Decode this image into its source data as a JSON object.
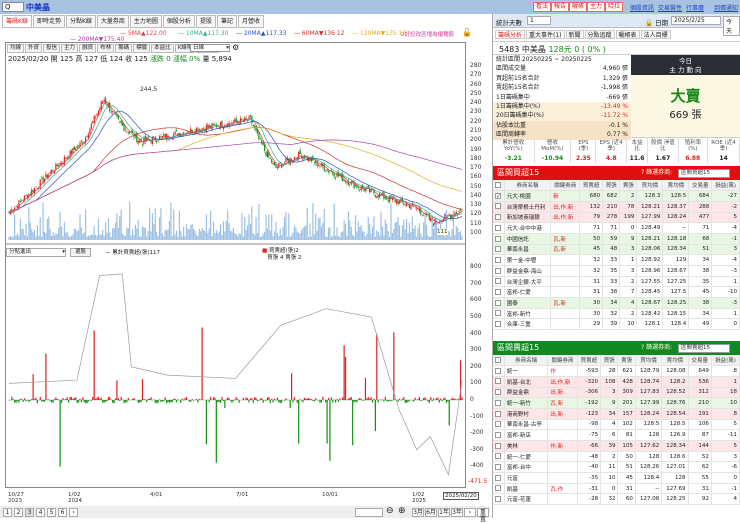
{
  "header": {
    "search": "Q",
    "stock_name": "中美晶",
    "buttons": [
      "看法",
      "報告",
      "曬帳",
      "主力",
      "哈拉"
    ],
    "links": [
      "個股資訊",
      "交易醫性",
      "行事曆",
      "到價通知"
    ]
  },
  "tabs": [
    "籌碼K線",
    "即時走勢",
    "分點K線",
    "大量券商",
    "主力地圖",
    "個股分析",
    "提股",
    "筆記",
    "月營收"
  ],
  "ma": [
    {
      "label": "5MA",
      "dir": "▲",
      "value": "122.00",
      "color": "#e04050"
    },
    {
      "label": "10MA",
      "dir": "▲",
      "value": "117.30",
      "color": "#30b090"
    },
    {
      "label": "20MA",
      "dir": "▲",
      "value": "117.33",
      "color": "#3050c0"
    },
    {
      "label": "60MA",
      "dir": "▼",
      "value": "136.12",
      "color": "#d03030"
    },
    {
      "label": "120MA",
      "dir": "▼",
      "value": "135.15",
      "color": "#e0b020"
    },
    {
      "label": "200MA",
      "dir": "▼",
      "value": "175.40",
      "color": "#b040b0"
    }
  ],
  "chart_hint": "⊙好記改區塊為優種股",
  "toolbar": [
    "均線",
    "外資",
    "投信",
    "主力",
    "融資",
    "布林",
    "籌碼",
    "標籤",
    "本益比",
    "K線帶",
    "分價圖"
  ],
  "period_select": "日線",
  "ohlc": {
    "date": "2025/02/20",
    "open_label": "開",
    "open": "125",
    "high_label": "高",
    "high": "127",
    "low_label": "低",
    "low": "124",
    "close_label": "收",
    "close": "125",
    "change_label": "漲跌",
    "change": "0",
    "pct_label": "漲幅",
    "pct": "0%",
    "vol_label": "量",
    "vol": "5,894"
  },
  "peak_label": "244.5",
  "low_label": "111",
  "price_axis": [
    "280",
    "270",
    "260",
    "250",
    "240",
    "230",
    "220",
    "210",
    "200",
    "190",
    "180",
    "170",
    "160",
    "150",
    "140",
    "130",
    "120",
    "110",
    "100"
  ],
  "lower": {
    "select": "分點進出",
    "button": "選股",
    "legend_line": "累計買賣超(張)117",
    "legend_bar": "買賣超(張)2",
    "legend_sub": "買張 4 賣張 2",
    "axis": [
      "800",
      "700",
      "600",
      "500",
      "400",
      "300",
      "200",
      "100",
      "0",
      "-100",
      "-200",
      "-300",
      "-400"
    ],
    "last_label": "-471.5"
  },
  "dates": [
    {
      "d": "10/27",
      "y": "2023"
    },
    {
      "d": "1/02",
      "y": "2024"
    },
    {
      "d": "4/01",
      "y": ""
    },
    {
      "d": "7/01",
      "y": ""
    },
    {
      "d": "10/01",
      "y": ""
    },
    {
      "d": "1/02",
      "y": "2025"
    }
  ],
  "current_date": "2025/02/20",
  "pages": [
    "1",
    "2",
    "3",
    "4",
    "5",
    "6",
    "›"
  ],
  "zoom_ranges": [
    "3月",
    "6月",
    "1年",
    "3年",
    "›",
    "重置"
  ],
  "chart_data": {
    "type": "candlestick",
    "price_keypoints": [
      [
        "2023/10/27",
        122
      ],
      [
        "2023/11/20",
        145
      ],
      [
        "2023/12/20",
        175
      ],
      [
        "2024/01/15",
        200
      ],
      [
        "2024/02/05",
        244.5
      ],
      [
        "2024/02/20",
        220
      ],
      [
        "2024/03/15",
        198
      ],
      [
        "2024/04/15",
        205
      ],
      [
        "2024/05/15",
        212
      ],
      [
        "2024/06/15",
        218
      ],
      [
        "2024/07/10",
        222
      ],
      [
        "2024/07/20",
        198
      ],
      [
        "2024/08/05",
        170
      ],
      [
        "2024/09/01",
        185
      ],
      [
        "2024/10/01",
        168
      ],
      [
        "2024/11/01",
        150
      ],
      [
        "2024/12/01",
        138
      ],
      [
        "2025/01/02",
        128
      ],
      [
        "2025/01/20",
        111
      ],
      [
        "2025/02/20",
        125
      ]
    ],
    "y_range": [
      100,
      280
    ],
    "net_y_range": [
      -471.5,
      800
    ]
  },
  "right": {
    "days_label": "統計天數",
    "days": "1",
    "date_label": "日期",
    "date": "2025/2/25",
    "today_btn": "今天",
    "tabs": [
      "籌碼分析",
      "重大事件(1)",
      "新聞",
      "分點追蹤",
      "曬帳表",
      "法人目標"
    ],
    "stock": {
      "code_name": "5483 中美晶",
      "price": "128元 0 ( 0% )"
    },
    "stats_period": "統計區間  20250225 ~ 20250225",
    "stats": [
      {
        "k": "區間成交量",
        "v": "4,960 張"
      },
      {
        "k": "買超前15名合計",
        "v": "1,329 張"
      },
      {
        "k": "賣超前15名合計",
        "v": "-1,998 張"
      },
      {
        "k": "1日籌碼集中",
        "v": "-669 張"
      },
      {
        "k": "1日籌碼集中(%)",
        "v": "-13.49 %"
      },
      {
        "k": "20日籌碼集中(%)",
        "v": "-11.72 %"
      },
      {
        "k": "佔股本比重",
        "v": "-0.1 %"
      },
      {
        "k": "區間周轉率",
        "v": "0.77 %"
      }
    ],
    "today": {
      "t1": "今日",
      "t2": "主 力 動 向",
      "verdict": "大賣",
      "amount": "669 張"
    },
    "fund": [
      {
        "h": "累計營收 YoY(%)",
        "v": "-3.21",
        "c": "#1a8a1a"
      },
      {
        "h": "營收 MoM(%)",
        "v": "-10.94",
        "c": "#1a8a1a"
      },
      {
        "h": "EPS (季)",
        "v": "2.35",
        "c": "#d22"
      },
      {
        "h": "EPS (近4季)",
        "v": "4.8",
        "c": "#d22"
      },
      {
        "h": "本益比",
        "v": "11.6",
        "c": "#222"
      },
      {
        "h": "股價 淨值比",
        "v": "1.67",
        "c": "#222"
      },
      {
        "h": "殖利率 (%)",
        "v": "6.88",
        "c": "#d22"
      },
      {
        "h": "ROE (近4季)",
        "v": "14",
        "c": "#222"
      }
    ],
    "buy": {
      "title": "區間買超15",
      "filter_label": "篩選券商:",
      "filter": "區間買超15",
      "cols": [
        "券商名稱",
        "關鍵券商",
        "買賣超",
        "買張",
        "賣張",
        "買均價",
        "賣均價",
        "交易量",
        "損益(萬)"
      ],
      "rows": [
        [
          "元大-桃園",
          "新",
          "680",
          "682",
          "2",
          "128.3",
          "128.5",
          "684",
          "-27",
          "g"
        ],
        [
          "台灣摩根士丹利",
          "出,作,新",
          "132",
          "210",
          "78",
          "128.21",
          "128.37",
          "288",
          "-2",
          "p"
        ],
        [
          "新加坡商瑞銀",
          "出,作,新",
          "79",
          "278",
          "199",
          "127.99",
          "128.24",
          "477",
          "5",
          "p"
        ],
        [
          "元大-台中中港",
          "",
          "71",
          "71",
          "0",
          "128.49",
          "--",
          "71",
          "-4",
          ""
        ],
        [
          "中國信託",
          "瓦,新",
          "50",
          "59",
          "9",
          "128.21",
          "128.18",
          "68",
          "-1",
          "g"
        ],
        [
          "華南永昌",
          "瓦,新",
          "45",
          "48",
          "3",
          "128.06",
          "128.34",
          "51",
          "3",
          "g"
        ],
        [
          "第一金-中壢",
          "",
          "32",
          "33",
          "1",
          "128.92",
          "129",
          "34",
          "-4",
          ""
        ],
        [
          "群益金鼎-海山",
          "",
          "32",
          "35",
          "3",
          "128.96",
          "128.67",
          "38",
          "-3",
          ""
        ],
        [
          "台灣企銀-大平",
          "",
          "31",
          "33",
          "2",
          "127.55",
          "127.25",
          "35",
          "1",
          ""
        ],
        [
          "富邦-仁愛",
          "",
          "31",
          "38",
          "7",
          "128.45",
          "127.5",
          "45",
          "-10",
          ""
        ],
        [
          "國泰",
          "瓦,新",
          "30",
          "34",
          "4",
          "128.67",
          "128.25",
          "38",
          "-3",
          "g"
        ],
        [
          "富邦-新竹",
          "",
          "30",
          "32",
          "2",
          "128.42",
          "128.15",
          "34",
          "1",
          ""
        ],
        [
          "合庫-三重",
          "",
          "29",
          "39",
          "10",
          "128.1",
          "128.4",
          "49",
          "0",
          ""
        ]
      ]
    },
    "sell": {
      "title": "區間賣超15",
      "filter_label": "篩選券商:",
      "filter": "區間賣超15",
      "cols": [
        "券商名稱",
        "關鍵券商",
        "買賣超",
        "買張",
        "賣張",
        "買均價",
        "賣均價",
        "交易量",
        "損益(萬)"
      ],
      "rows": [
        [
          "統一",
          "作",
          "-593",
          "28",
          "621",
          "128.79",
          "128.08",
          "649",
          "8",
          ""
        ],
        [
          "凱基-台北",
          "出,作,新",
          "-320",
          "108",
          "428",
          "128.74",
          "128.2",
          "536",
          "1",
          "p"
        ],
        [
          "群益金鼎",
          "出,新",
          "-306",
          "3",
          "309",
          "127.83",
          "128.52",
          "312",
          "18",
          "p"
        ],
        [
          "統一-新竹",
          "瓦,新",
          "-192",
          "9",
          "201",
          "127.99",
          "128.76",
          "210",
          "10",
          "g"
        ],
        [
          "港商野村",
          "出,新",
          "-123",
          "34",
          "157",
          "128.24",
          "128.54",
          "191",
          "8",
          "p"
        ],
        [
          "華南永昌-古亭",
          "",
          "-98",
          "4",
          "102",
          "128.5",
          "128.5",
          "106",
          "5",
          ""
        ],
        [
          "富邦-新店",
          "",
          "-75",
          "6",
          "81",
          "128",
          "126.9",
          "87",
          "-11",
          ""
        ],
        [
          "美林",
          "作,新",
          "-66",
          "39",
          "105",
          "127.62",
          "128.34",
          "144",
          "5",
          "p"
        ],
        [
          "統一-仁愛",
          "",
          "-48",
          "2",
          "50",
          "128",
          "128.6",
          "52",
          "3",
          ""
        ],
        [
          "富邦-台中",
          "",
          "-40",
          "11",
          "51",
          "128.26",
          "127.01",
          "62",
          "-6",
          ""
        ],
        [
          "元富",
          "",
          "-35",
          "10",
          "45",
          "128.4",
          "128",
          "55",
          "0",
          ""
        ],
        [
          "凱基",
          "瓦,作",
          "-31",
          "0",
          "31",
          "--",
          "127.69",
          "31",
          "-1",
          ""
        ],
        [
          "元富-花蓮",
          "",
          "-28",
          "32",
          "60",
          "127.08",
          "128.25",
          "92",
          "4",
          ""
        ]
      ]
    }
  }
}
